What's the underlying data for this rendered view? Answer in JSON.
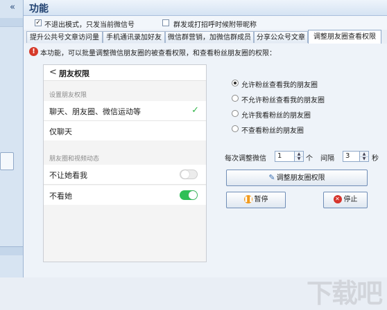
{
  "left": {
    "collapse": "«"
  },
  "header": {
    "title": "功能"
  },
  "options": {
    "no_exit_mode": {
      "label": "不退出模式，只发当前微信号",
      "checked": true
    },
    "with_nickname": {
      "label": "群发或打招呼时候附带昵称",
      "checked": false
    }
  },
  "tabs": [
    {
      "label": "提升公共号文章访问量"
    },
    {
      "label": "手机通讯录加好友"
    },
    {
      "label": "微信群营销，加微信群成员"
    },
    {
      "label": "分享公众号文章"
    },
    {
      "label": "调整朋友圈查看权限",
      "active": true
    }
  ],
  "info": {
    "icon": "!",
    "text": "本功能，可以批量调整微信朋友圈的被查看权限，和查看粉丝朋友圈的权限："
  },
  "phone": {
    "back": "<",
    "title": "朋友权限",
    "section1": "设置朋友权限",
    "opt_all": "聊天、朋友圈、微信运动等",
    "opt_chat": "仅聊天",
    "check": "✓",
    "section2": "朋友圈和视频动态",
    "block_me": {
      "label": "不让她看我",
      "on": false
    },
    "hide_her": {
      "label": "不看她",
      "on": true
    }
  },
  "permissions": {
    "options": [
      {
        "label": "允许粉丝查看我的朋友圈",
        "checked": true
      },
      {
        "label": "不允许粉丝查看我的朋友圈",
        "checked": false
      },
      {
        "label": "允许我看粉丝的朋友圈",
        "checked": false
      },
      {
        "label": "不查看粉丝的朋友圈",
        "checked": false
      }
    ]
  },
  "per_adjust": {
    "label": "每次调整微信",
    "value": "1",
    "unit": "个"
  },
  "interval": {
    "label": "间隔",
    "value": "3",
    "unit": "秒"
  },
  "buttons": {
    "adjust": "调整朋友圈权限",
    "pause": "暂停",
    "stop": "停止"
  },
  "watermark": "下载吧"
}
